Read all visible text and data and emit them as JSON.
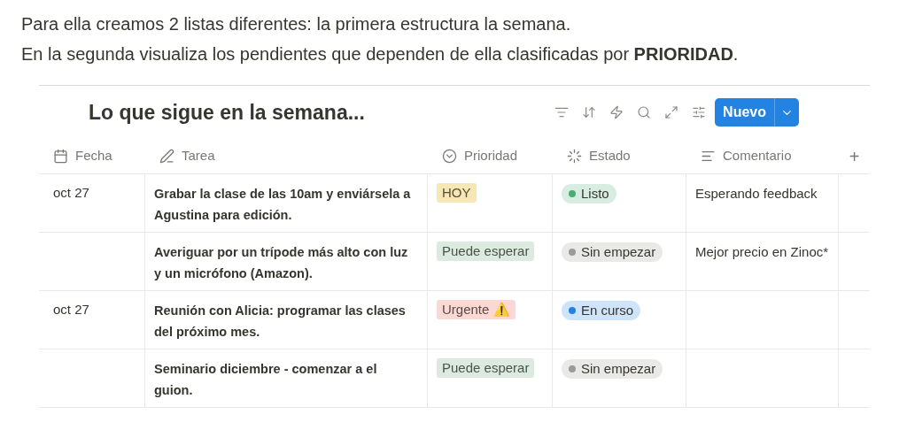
{
  "intro": [
    "Para ella creamos 2 listas diferentes: la primera estructura la semana.",
    "En la segunda visualiza los pendientes que dependen de ella clasificadas por **PRIORIDAD**."
  ],
  "database": {
    "title": "Lo que sigue en la semana...",
    "new_button": "Nuevo",
    "columns": [
      {
        "label": "Fecha",
        "kind": "date"
      },
      {
        "label": "Tarea",
        "kind": "text"
      },
      {
        "label": "Prioridad",
        "kind": "select"
      },
      {
        "label": "Estado",
        "kind": "status"
      },
      {
        "label": "Comentario",
        "kind": "comment"
      }
    ],
    "add_column": "+",
    "rows": [
      {
        "fecha": "oct 27",
        "tarea": "Grabar la clase de las 10am y enviársela a Agustina para edición.",
        "prioridad": {
          "label": "HOY",
          "color": "#f7e7b4"
        },
        "estado": {
          "label": "Listo",
          "color": "#4dab76"
        },
        "comentario": "Esperando feedback"
      },
      {
        "tarea": "Averiguar por un trípode más alto con luz y un micrófono (Amazon).",
        "prioridad": {
          "label": "Puede esperar",
          "color": "#dbebe0"
        },
        "estado": {
          "label": "Sin empezar",
          "color": "#9b9a97"
        },
        "comentario": "Mejor precio en Zinoc*"
      },
      {
        "fecha": "oct 27",
        "tarea": "Reunión con Alicia: programar las clases del próximo mes.",
        "prioridad": {
          "label": "Urgente ⚠️",
          "color": "#fbd8d3"
        },
        "estado": {
          "label": "En curso",
          "color": "#2383e2"
        }
      },
      {
        "tarea": "Seminario diciembre - comenzar a el guion.",
        "prioridad": {
          "label": "Puede esperar",
          "color": "#dbebe0"
        },
        "estado": {
          "label": "Sin empezar",
          "color": "#9b9a97"
        }
      }
    ]
  }
}
